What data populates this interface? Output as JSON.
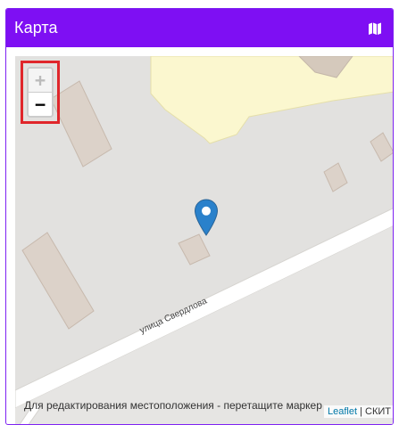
{
  "panel": {
    "title": "Карта",
    "icon": "map-icon",
    "header_color": "#7e0ff3"
  },
  "map": {
    "zoom_in_label": "+",
    "zoom_out_label": "−",
    "zoom_in_disabled": true,
    "street_name": "улица Свердлова",
    "hint": "Для редактирования местоположения - перетащите маркер",
    "attribution_link": "Leaflet",
    "attribution_separator": " | ",
    "attribution_provider": "СКИТ",
    "marker_icon": "map-marker-icon",
    "marker_color": "#2a81cb",
    "highlight_color": "#e0262b"
  }
}
